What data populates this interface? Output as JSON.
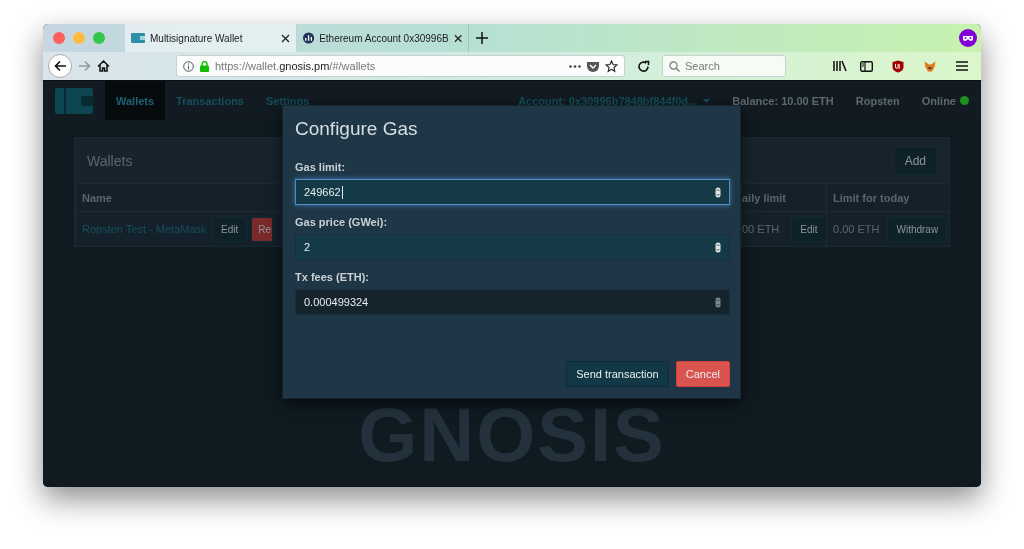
{
  "browser": {
    "tabs": [
      {
        "title": "Multisignature Wallet",
        "selected": true
      },
      {
        "title": "Ethereum Account 0x30996B",
        "selected": false
      }
    ],
    "url": {
      "prefix": "https://wallet.",
      "host": "gnosis.pm",
      "path": "/#/wallets"
    },
    "search": {
      "placeholder": "Search"
    }
  },
  "app": {
    "nav": [
      {
        "label": "Wallets",
        "selected": true
      },
      {
        "label": "Transactions",
        "selected": false
      },
      {
        "label": "Settings",
        "selected": false
      }
    ],
    "account": "Account: 0x30996b7848bf844f0d...",
    "balance": "Balance: 10.00 ETH",
    "network": "Ropsten",
    "status": {
      "label": "Online",
      "color": "#1f8f1f"
    }
  },
  "wallets": {
    "title": "Wallets",
    "add": "Add",
    "columns": [
      "Name",
      "aily limit",
      "Limit for today"
    ],
    "rows": [
      {
        "name": "Ropsten Test - MetaMask",
        "actions": [
          {
            "label": "Edit",
            "kind": "default"
          },
          {
            "label": "Re",
            "kind": "danger"
          }
        ],
        "daily": "00 ETH",
        "daily_action": "Edit",
        "today": "0.00 ETH",
        "today_action": "Withdraw"
      }
    ]
  },
  "background_logo": "GNOSIS",
  "modal": {
    "title": "Configure Gas",
    "fields": [
      {
        "label": "Gas limit:",
        "value": "249662",
        "focused": true,
        "readonly": false
      },
      {
        "label": "Gas price (GWei):",
        "value": "2",
        "focused": false,
        "readonly": false
      },
      {
        "label": "Tx fees (ETH):",
        "value": "0.000499324",
        "focused": false,
        "readonly": true
      }
    ],
    "buttons": [
      {
        "label": "Send transaction",
        "kind": "primary"
      },
      {
        "label": "Cancel",
        "kind": "danger"
      }
    ]
  }
}
